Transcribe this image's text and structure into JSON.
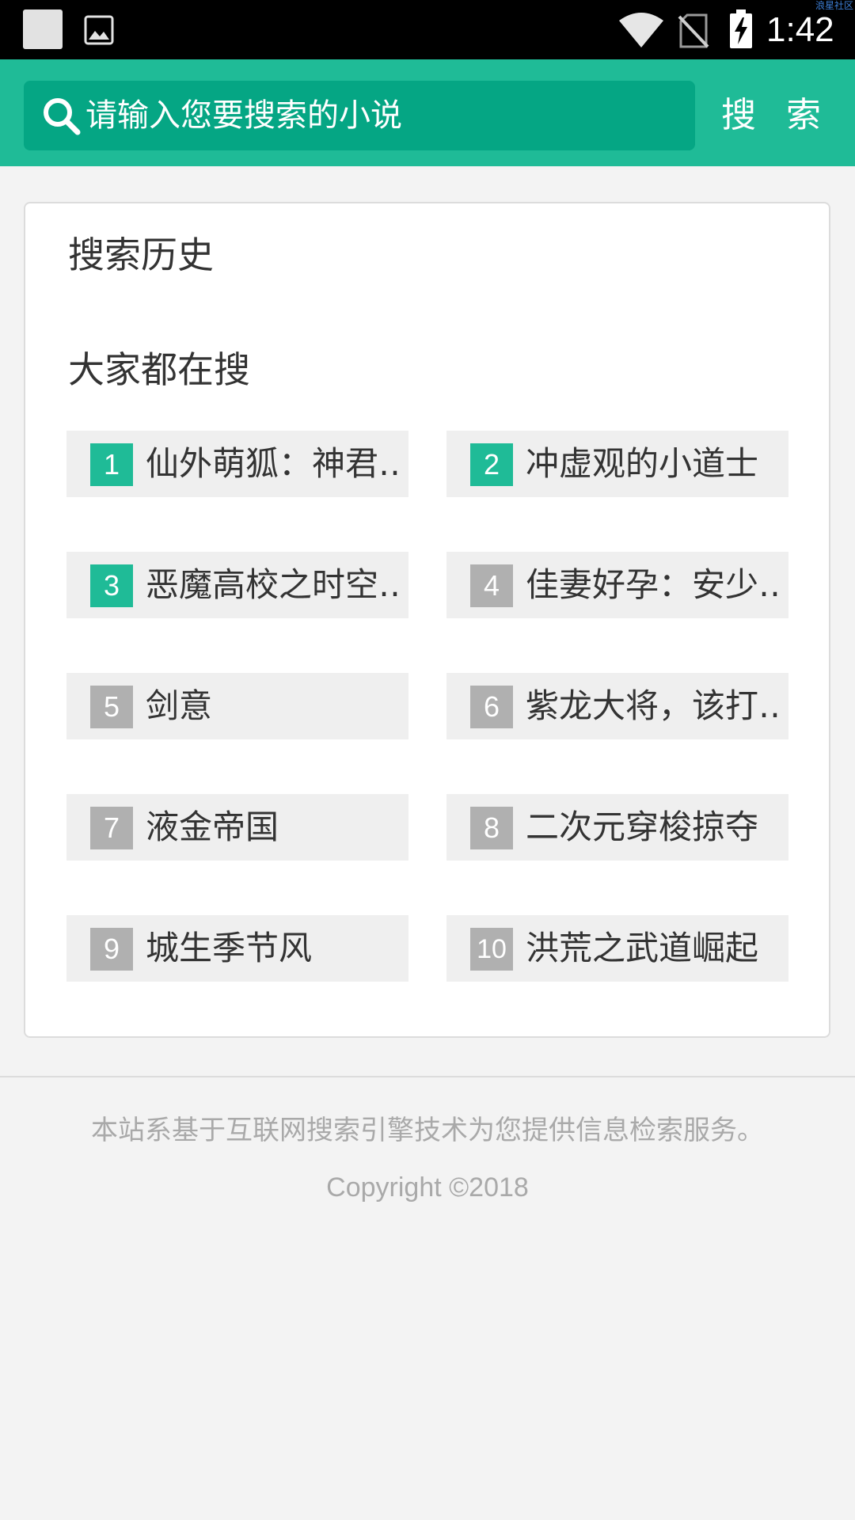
{
  "status_bar": {
    "time": "1:42",
    "watermark": "浪星社区"
  },
  "search": {
    "placeholder": "请输入您要搜索的小说",
    "button_label": "搜 索"
  },
  "history": {
    "title": "搜索历史"
  },
  "hot": {
    "title": "大家都在搜",
    "items": [
      {
        "rank": "1",
        "title": "仙外萌狐：神君…",
        "highlight": true
      },
      {
        "rank": "2",
        "title": "冲虚观的小道士",
        "highlight": true
      },
      {
        "rank": "3",
        "title": "恶魔高校之时空…",
        "highlight": true
      },
      {
        "rank": "4",
        "title": "佳妻好孕：安少…",
        "highlight": false
      },
      {
        "rank": "5",
        "title": "剑意",
        "highlight": false
      },
      {
        "rank": "6",
        "title": "紫龙大将，该打…",
        "highlight": false
      },
      {
        "rank": "7",
        "title": "液金帝国",
        "highlight": false
      },
      {
        "rank": "8",
        "title": "二次元穿梭掠夺",
        "highlight": false
      },
      {
        "rank": "9",
        "title": "城生季节风",
        "highlight": false
      },
      {
        "rank": "10",
        "title": "洪荒之武道崛起",
        "highlight": false
      }
    ]
  },
  "footer": {
    "disclaimer": "本站系基于互联网搜索引擎技术为您提供信息检索服务。",
    "copyright": "Copyright ©2018"
  },
  "colors": {
    "accent": "#1fbb97",
    "search_field": "#05a684",
    "rank_inactive": "#b0b0b0"
  }
}
